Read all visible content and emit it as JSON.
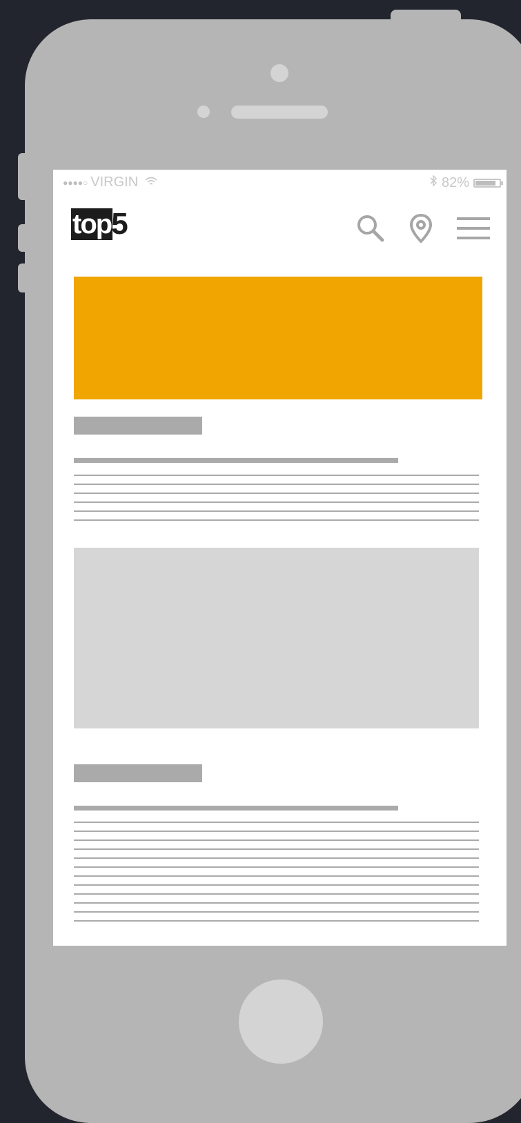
{
  "status_bar": {
    "signal_dots": "●●●●○",
    "carrier": "VIRGIN",
    "wifi_icon": "wifi-icon",
    "bluetooth_icon": "bluetooth-icon",
    "battery_percent": "82%",
    "battery_level": 0.82
  },
  "header": {
    "logo_text": "top",
    "logo_number": "5",
    "icons": [
      "search-icon",
      "location-pin-icon",
      "hamburger-menu-icon"
    ]
  },
  "colors": {
    "banner": "#f0a500",
    "background": "#23252e",
    "phone_body": "#b5b5b5",
    "placeholder": "#aaaaaa"
  }
}
